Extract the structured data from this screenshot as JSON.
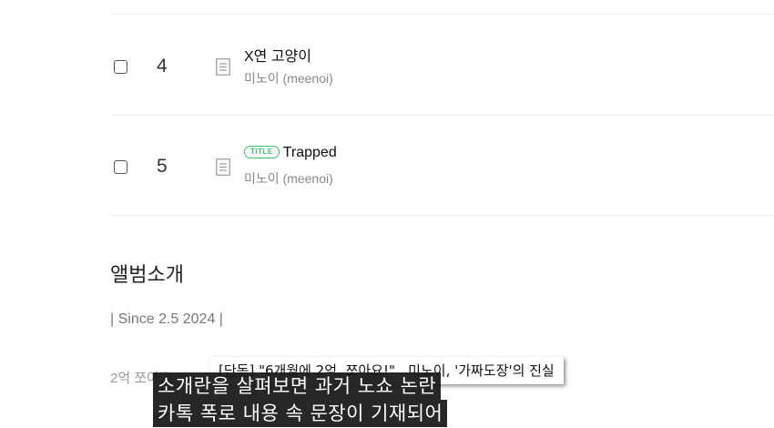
{
  "tracks": [
    {
      "number": "4",
      "title": "X연 고양이",
      "artist": "미노이 (meenoi)",
      "is_title": false
    },
    {
      "number": "5",
      "title": "Trapped",
      "artist": "미노이 (meenoi)",
      "is_title": true,
      "badge": "TITLE"
    }
  ],
  "album_intro": {
    "heading": "앨범소개",
    "since": "| Since 2.5 2024 |",
    "text": "2억 쪼아요"
  },
  "news_overlay": {
    "headline": "[단독] \"6개월에 2억, 쪼아요!\"...미노이, '가짜도장'의 진실"
  },
  "captions": [
    "소개란을 살펴보면 과거 노쇼 논란",
    "카톡 폭로 내용 속 문장이 기재되어"
  ],
  "colors": {
    "title_badge": "#33c466",
    "caption_bg": "#191919"
  }
}
